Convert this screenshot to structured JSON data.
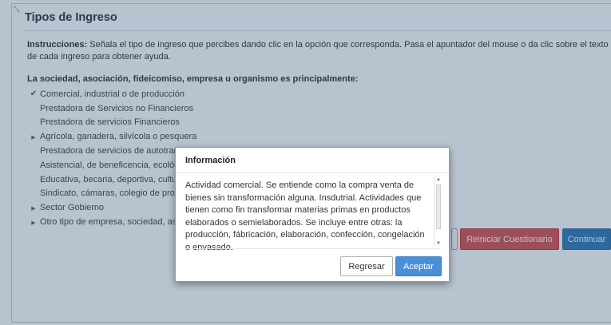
{
  "panel": {
    "grip": "⤡",
    "title": "Tipos de Ingreso",
    "instructions_label": "Instrucciones:",
    "instructions_text": " Señala el tipo de ingreso que percibes dando clic en la opción que corresponda. Pasa el apuntador del mouse o da clic sobre el texto de cada ingreso para obtener ayuda.",
    "question": "La sociedad, asociación, fideicomiso, empresa u organismo es principalmente:"
  },
  "options": [
    {
      "label": "Comercial, industrial o de producción",
      "state": "checked"
    },
    {
      "label": "Prestadora de Servicios no Financieros",
      "state": "box"
    },
    {
      "label": "Prestadora de servicios Financieros",
      "state": "box"
    },
    {
      "label": "Agrícola, ganadera, silvícola o pesquera",
      "state": "expand"
    },
    {
      "label": "Prestadora de servicios de autotransporte terrestre o complementarios",
      "state": "box"
    },
    {
      "label": "Asistencial, de beneficencia, ecológica",
      "state": "box"
    },
    {
      "label": "Educativa, becaria, deportiva, cultural",
      "state": "box"
    },
    {
      "label": "Sindicato, cámaras, colegio de profesionistas",
      "state": "box"
    },
    {
      "label": "Sector Gobierno",
      "state": "expand"
    },
    {
      "label": "Otro tipo de empresa, sociedad, asociación",
      "state": "expand"
    }
  ],
  "buttons": {
    "reset": "Reiniciar Cuestionario",
    "continue": "Continuar"
  },
  "modal": {
    "title": "Información",
    "body": "Actividad comercial. Se entiende como la compra venta de bienes sin transformación alguna. Insdutrial. Actividades que tienen como fin transformar materias primas en productos elaborados o semielaborados. Se incluye entre otras: la producción, fábricación, elaboración, confección, congelación o envasado.",
    "back": "Regresar",
    "ok": "Aceptar"
  },
  "colors": {
    "danger": "#d9534f",
    "primary": "#337ab7",
    "accept": "#4a90d9",
    "overlay": "#20466e"
  }
}
